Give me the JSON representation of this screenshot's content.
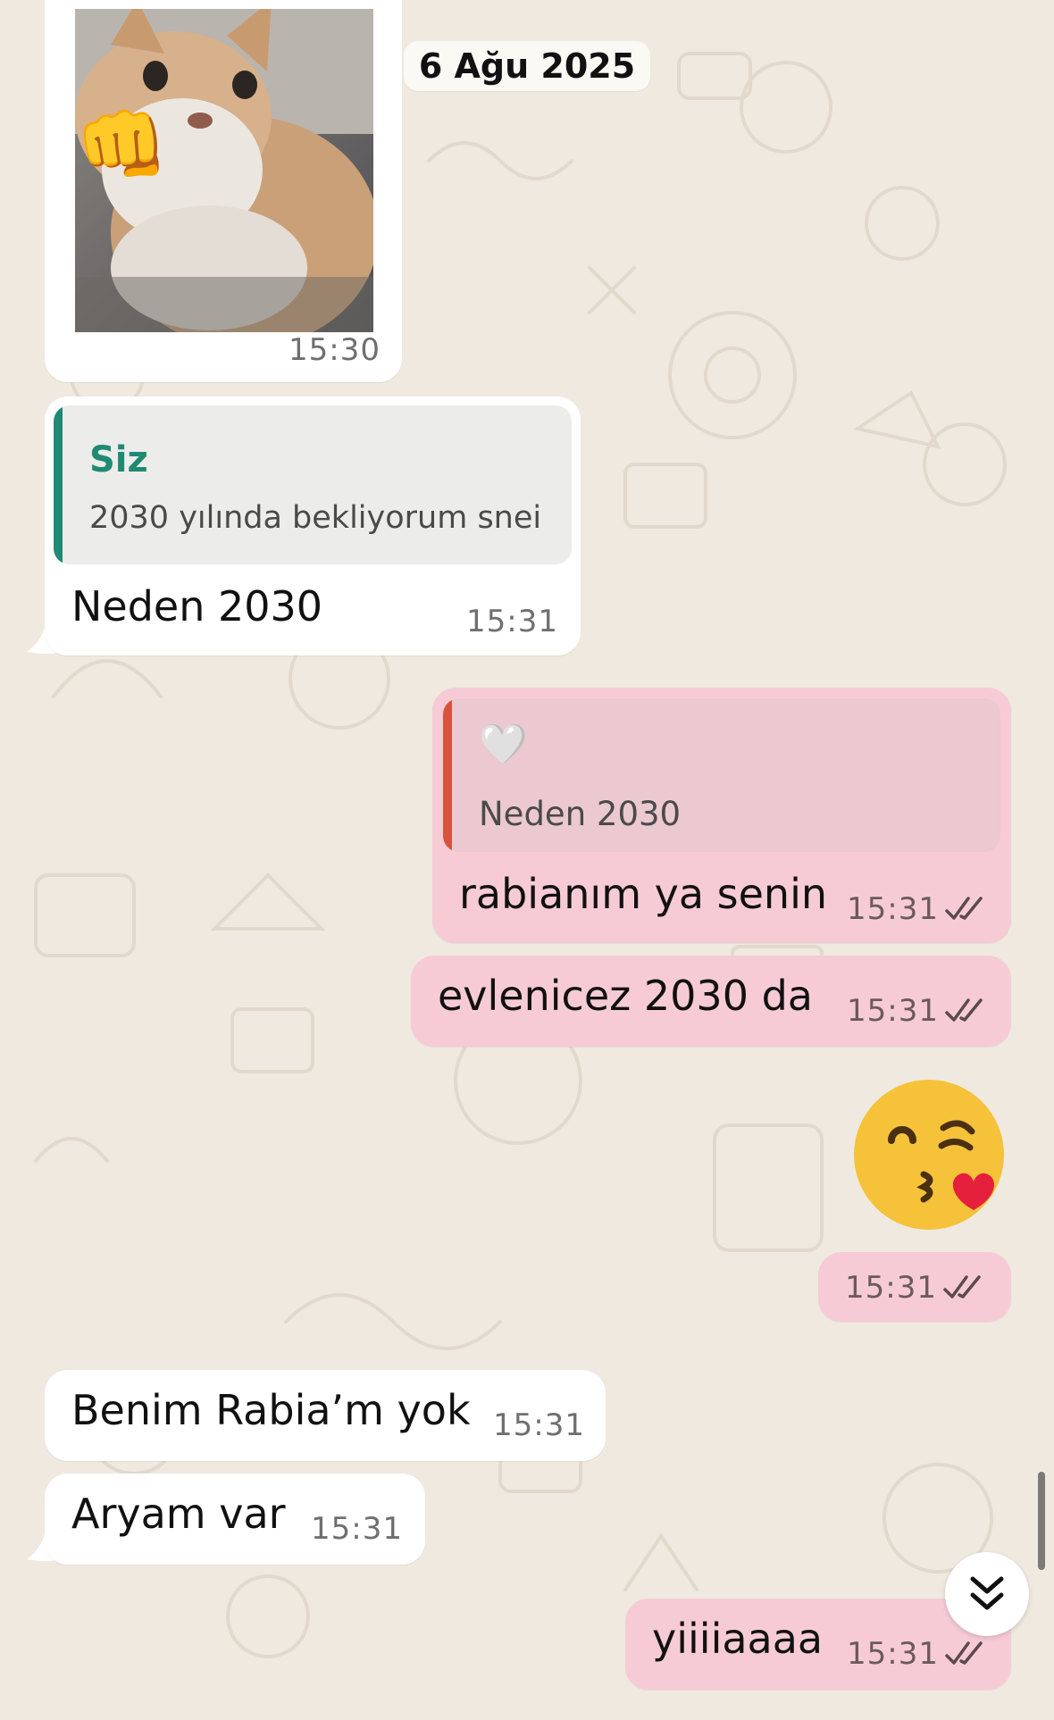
{
  "date_chip": "6 Ağu 2025",
  "colors": {
    "background": "#efe9e0",
    "incoming": "#ffffff",
    "outgoing": "#f7cbd6",
    "quote_author_self": "#1f8a73",
    "quote_bar_in": "#1f8a73",
    "quote_bar_out": "#d9533a",
    "read_ticks": "#5a4a50"
  },
  "messages": {
    "m1": {
      "type": "image",
      "image": "cat-with-fist-emoji",
      "fist_emoji": "👊",
      "time": "15:30"
    },
    "m2": {
      "quote_author": "Siz",
      "quote_text": "2030 yılında bekliyorum snei",
      "text": "Neden 2030",
      "time": "15:31"
    },
    "m3": {
      "quote_emoji": "🤍",
      "quote_text": "Neden 2030",
      "text": "rabianım ya senin",
      "time": "15:31",
      "status": "read"
    },
    "m4": {
      "text": "evlenicez 2030 da",
      "time": "15:31",
      "status": "read"
    },
    "m5": {
      "emoji": "😘",
      "time": "15:31",
      "status": "read"
    },
    "m6": {
      "text": "Benim Rabia’m yok",
      "time": "15:31"
    },
    "m7": {
      "text": "Aryam var",
      "time": "15:31"
    },
    "m8": {
      "text": "yiiiiaaaa",
      "time": "15:31",
      "status": "read"
    }
  },
  "icons": {
    "scroll_down": "double-chevron-down-icon",
    "read_receipt": "double-check-icon"
  }
}
